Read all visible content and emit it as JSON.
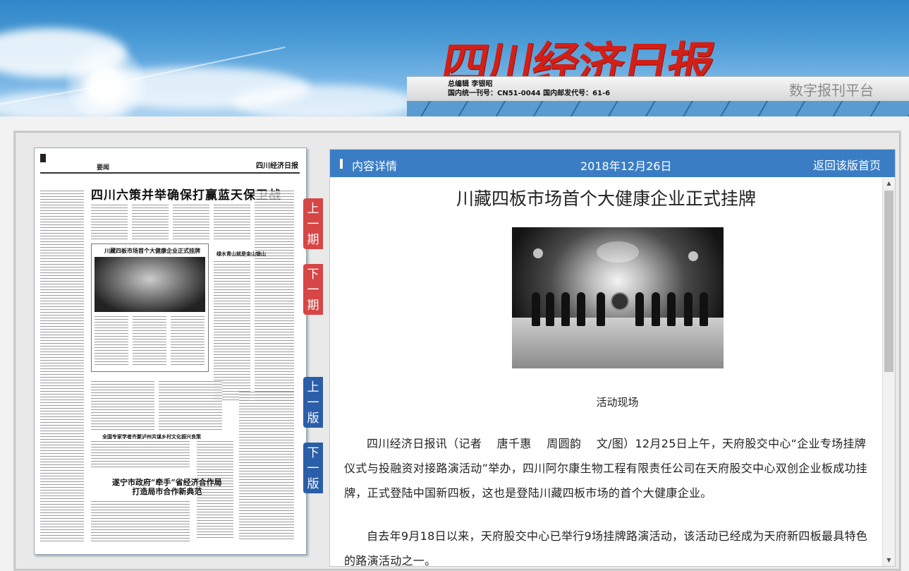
{
  "header": {
    "logo_text": "四川经济日报",
    "editor_line": "总编辑 李银昭",
    "issn_line": "国内统一刊号：CN51-0044 国内邮发代号：61-6",
    "platform_label": "数字报刊平台"
  },
  "newspaper_page": {
    "masthead": "四川经济日报",
    "section": "要闻",
    "headline": "四川六策并举确保打赢蓝天保卫战",
    "box_title": "川藏四板市场首个大健康企业正式挂牌",
    "sub_headline_1": "绿水青山就是金山银山",
    "sub_headline_2": "全国专家学者齐聚泸州共谋乡村文化振兴良策",
    "big_headline": "遂宁市政府“牵手”省经济合作局\n打造局市合作新典范"
  },
  "side_nav": {
    "prev_issue": "上一期",
    "next_issue": "下一期",
    "prev_page": "上一版",
    "next_page": "下一版"
  },
  "panel": {
    "section_label": "内容详情",
    "date": "2018年12月26日",
    "back_link": "返回该版首页"
  },
  "article": {
    "title": "川藏四板市场首个大健康企业正式挂牌",
    "photo_caption": "活动现场",
    "paragraphs": [
      "四川经济日报讯（记者　 唐千惠　 周圆韵　 文/图）12月25日上午，天府股交中心“企业专场挂牌仪式与投融资对接路演活动”举办，四川阿尔康生物工程有限责任公司在天府股交中心双创企业板成功挂牌，正式登陆中国新四板，这也是登陆川藏四板市场的首个大健康企业。",
      "自去年9月18日以来，天府股交中心已举行9场挂牌路演活动，该活动已经成为天府新四板最具特色的路演活动之一。"
    ]
  },
  "colors": {
    "header_blue": "#3a7dc4",
    "logo_red": "#d21f17",
    "nav_red": "#d64646",
    "nav_blue": "#2a5ea8"
  }
}
